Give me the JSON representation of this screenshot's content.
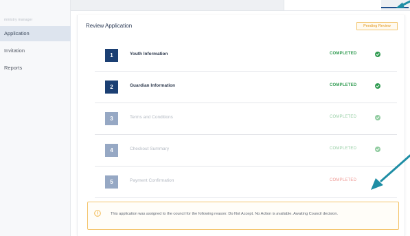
{
  "sidebar": {
    "title": "ministry manager",
    "items": [
      {
        "label": "Application",
        "active": true
      },
      {
        "label": "Invitation",
        "active": false
      },
      {
        "label": "Reports",
        "active": false
      }
    ]
  },
  "card": {
    "title": "Review Application",
    "badge": "Pending Review"
  },
  "steps": [
    {
      "number": "1",
      "name": "Youth Information",
      "status": "COMPLETED",
      "status_type": "completed",
      "muted": false
    },
    {
      "number": "2",
      "name": "Guardian Information",
      "status": "COMPLETED",
      "status_type": "completed",
      "muted": false
    },
    {
      "number": "3",
      "name": "Terms and Conditions",
      "status": "COMPLETED",
      "status_type": "completed",
      "muted": true
    },
    {
      "number": "4",
      "name": "Checkout Summary",
      "status": "COMPLETED",
      "status_type": "completed",
      "muted": true
    },
    {
      "number": "5",
      "name": "Payment Confirmation",
      "status": "COMPLETED",
      "status_type": "error",
      "muted": true
    }
  ],
  "notice": {
    "icon": "warning-circle-icon",
    "text": "This application was assigned to the council for the following reason: Do Not Accept. No Action is available. Awaiting Council decision."
  },
  "colors": {
    "brand_navy": "#1b3f73",
    "success": "#2e9a4f",
    "warning": "#f4c46a",
    "arrow": "#1f8ea5"
  }
}
